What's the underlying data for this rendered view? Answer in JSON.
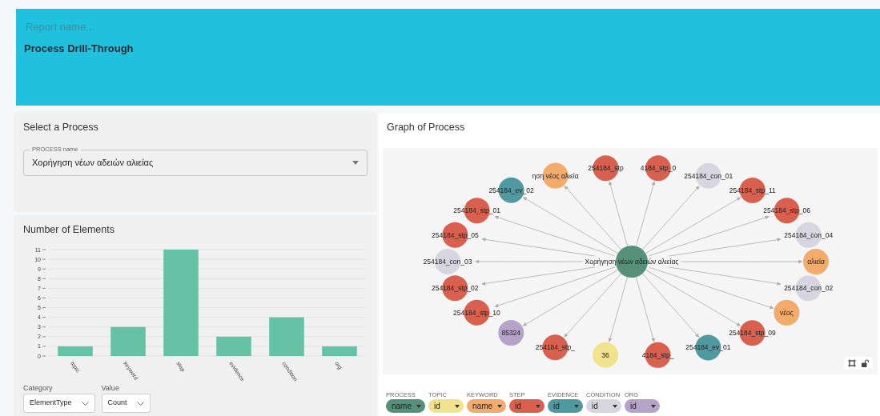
{
  "report": {
    "placeholder": "Report name...",
    "title": "Process Drill-Through"
  },
  "select_card": {
    "title": "Select a Process",
    "field": {
      "label": "PROCESS name",
      "value": "Χορήγηση νέων αδειών αλιείας"
    }
  },
  "chart_card": {
    "title": "Number of Elements",
    "chart_data": {
      "type": "bar",
      "categories": [
        "topic",
        "keyword",
        "step",
        "evidence",
        "condition",
        "org"
      ],
      "series": [
        {
          "color": "#66c2a5",
          "values": [
            1,
            3,
            11,
            2,
            4,
            1
          ]
        }
      ],
      "ylim": [
        0,
        11
      ],
      "grid": true,
      "yticks": [
        0,
        1,
        2,
        3,
        4,
        5,
        6,
        7,
        8,
        9,
        10,
        11
      ]
    },
    "controls": [
      {
        "label": "Category",
        "value": "ElementType"
      },
      {
        "label": "Value",
        "value": "Count"
      }
    ]
  },
  "graph_card": {
    "title": "Graph of Process",
    "center": {
      "label": "Χορήγηση νέων αδειών αλιείας",
      "color": "#56907a"
    },
    "nodes": [
      {
        "label": "254184_stp",
        "color": "#d9604f"
      },
      {
        "label": "4184_stp_0",
        "color": "#d9604f"
      },
      {
        "label": "ηση νέος αλιεία",
        "color": "#f2ab6b"
      },
      {
        "label": "254184_con_01",
        "color": "#d7d5e0"
      },
      {
        "label": "254184_ev_02",
        "color": "#4f9aa0"
      },
      {
        "label": "254184_stp_11",
        "color": "#d9604f"
      },
      {
        "label": "254184_stp_01",
        "color": "#d9604f"
      },
      {
        "label": "254184_stp_06",
        "color": "#d9604f"
      },
      {
        "label": "254184_stp_05",
        "color": "#d9604f"
      },
      {
        "label": "254184_con_04",
        "color": "#d7d5e0"
      },
      {
        "label": "254184_con_03",
        "color": "#d7d5e0"
      },
      {
        "label": "αλιεία",
        "color": "#f2ab6b"
      },
      {
        "label": "254184_stp_02",
        "color": "#d9604f"
      },
      {
        "label": "254184_con_02",
        "color": "#d7d5e0"
      },
      {
        "label": "254184_stp_10",
        "color": "#d9604f"
      },
      {
        "label": "νέος",
        "color": "#f2ab6b"
      },
      {
        "label": "85324",
        "color": "#b5a3c9"
      },
      {
        "label": "254184_stp_09",
        "color": "#d9604f"
      },
      {
        "label": "254184_stp_",
        "color": "#d9604f"
      },
      {
        "label": "254184_ev_01",
        "color": "#4f9aa0"
      },
      {
        "label": "36",
        "color": "#f1e38e"
      },
      {
        "label": "4184_stp_",
        "color": "#d9604f"
      }
    ],
    "legend": [
      {
        "label": "PROCESS",
        "value": "name",
        "color": "#56907a"
      },
      {
        "label": "TOPIC",
        "value": "id",
        "color": "#f1e38e"
      },
      {
        "label": "KEYWORD",
        "value": "name",
        "color": "#f2ab6b"
      },
      {
        "label": "STEP",
        "value": "id",
        "color": "#d9604f"
      },
      {
        "label": "EVIDENCE",
        "value": "id",
        "color": "#4f9aa0"
      },
      {
        "label": "CONDITION",
        "value": "id",
        "color": "#d7d5e0"
      },
      {
        "label": "ORG",
        "value": "id",
        "color": "#b5a3c9"
      }
    ]
  }
}
